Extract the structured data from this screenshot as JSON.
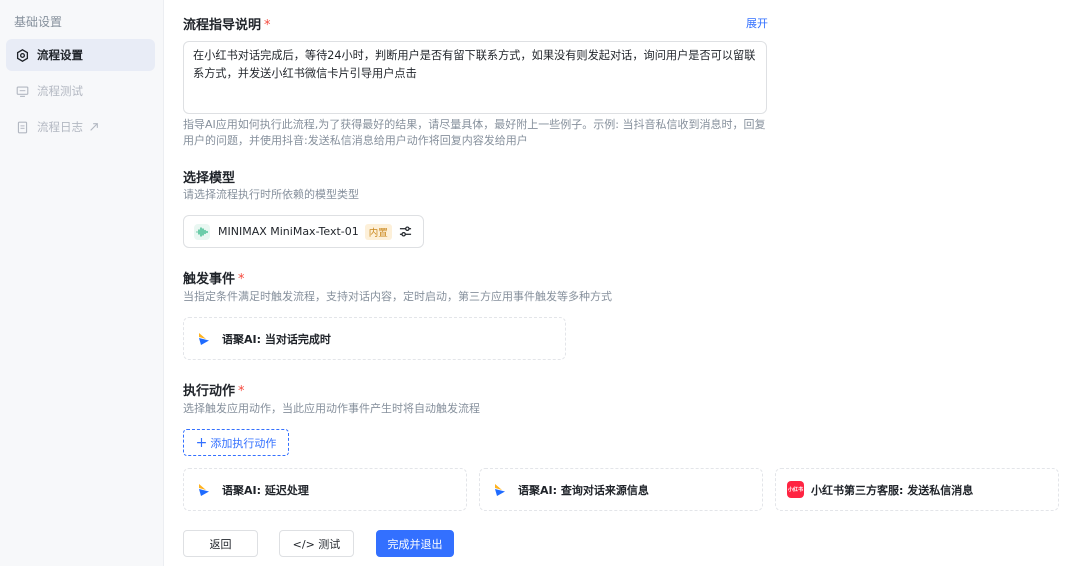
{
  "sidebar": {
    "heading": "基础设置",
    "items": [
      {
        "label": "流程设置",
        "icon": "settings-hexagon-icon",
        "state": "active"
      },
      {
        "label": "流程测试",
        "icon": "monitor-icon",
        "state": "disabled"
      },
      {
        "label": "流程日志",
        "icon": "document-icon",
        "state": "disabled",
        "external": true
      }
    ]
  },
  "guide": {
    "title": "流程指导说明",
    "required_mark": "*",
    "expand_label": "展开",
    "value": "在小红书对话完成后，等待24小时，判断用户是否有留下联系方式，如果没有则发起对话，询问用户是否可以留联系方式，并发送小红书微信卡片引导用户点击",
    "help": "指导AI应用如何执行此流程,为了获得最好的结果，请尽量具体，最好附上一些例子。示例: 当抖音私信收到消息时，回复用户的问题，并使用抖音:发送私信消息给用户动作将回复内容发给用户"
  },
  "model": {
    "title": "选择模型",
    "desc": "请选择流程执行时所依赖的模型类型",
    "selected": "MINIMAX MiniMax-Text-01",
    "tag": "内置"
  },
  "trigger": {
    "title": "触发事件",
    "required_mark": "*",
    "desc": "当指定条件满足时触发流程，支持对话内容，定时启动，第三方应用事件触发等多种方式",
    "card_label": "语聚AI: 当对话完成时"
  },
  "actions": {
    "title": "执行动作",
    "required_mark": "*",
    "desc": "选择触发应用动作，当此应用动作事件产生时将自动触发流程",
    "add_label": "添加执行动作",
    "xhs_badge": "小红书",
    "cards": [
      {
        "label": "语聚AI: 延迟处理",
        "icon": "yuju-ai-logo-icon"
      },
      {
        "label": "语聚AI: 查询对话来源信息",
        "icon": "yuju-ai-logo-icon"
      },
      {
        "label": "小红书第三方客服: 发送私信消息",
        "icon": "xiaohongshu-logo-icon"
      }
    ]
  },
  "footer": {
    "back": "返回",
    "test": "</> 测试",
    "finish": "完成并退出"
  },
  "colors": {
    "accent": "#3370ff",
    "required": "#f5493d",
    "xiaohongshu": "#ff2442"
  }
}
